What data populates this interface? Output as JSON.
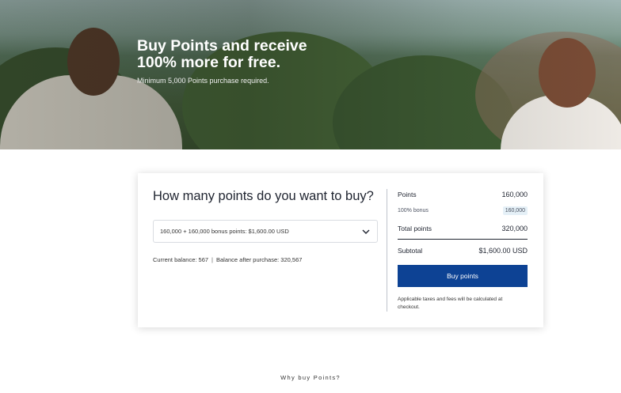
{
  "hero": {
    "title_line1": "Buy Points and receive",
    "title_line2": "100% more for free.",
    "subtitle": "Minimum 5,000 Points purchase required."
  },
  "purchase": {
    "question": "How many points do you want to buy?",
    "select_value": "160,000 + 160,000 bonus points: $1,600.00 USD",
    "balance": {
      "current": "Current balance: 567",
      "separator": "|",
      "after": "Balance after purchase: 320,567"
    }
  },
  "summary": {
    "points_label": "Points",
    "points_value": "160,000",
    "bonus_label": "100% bonus",
    "bonus_value": "160,000",
    "total_label": "Total points",
    "total_value": "320,000",
    "subtotal_label": "Subtotal",
    "subtotal_value": "$1,600.00 USD",
    "buy_button": "Buy points",
    "note": "Applicable taxes and fees will be calculated at checkout."
  },
  "footer": {
    "why_link": "Why buy Points?"
  },
  "colors": {
    "button": "#0d4294",
    "bonus_bg": "#e5f0f7"
  },
  "icons": {
    "dropdown": "chevron-down-icon"
  }
}
